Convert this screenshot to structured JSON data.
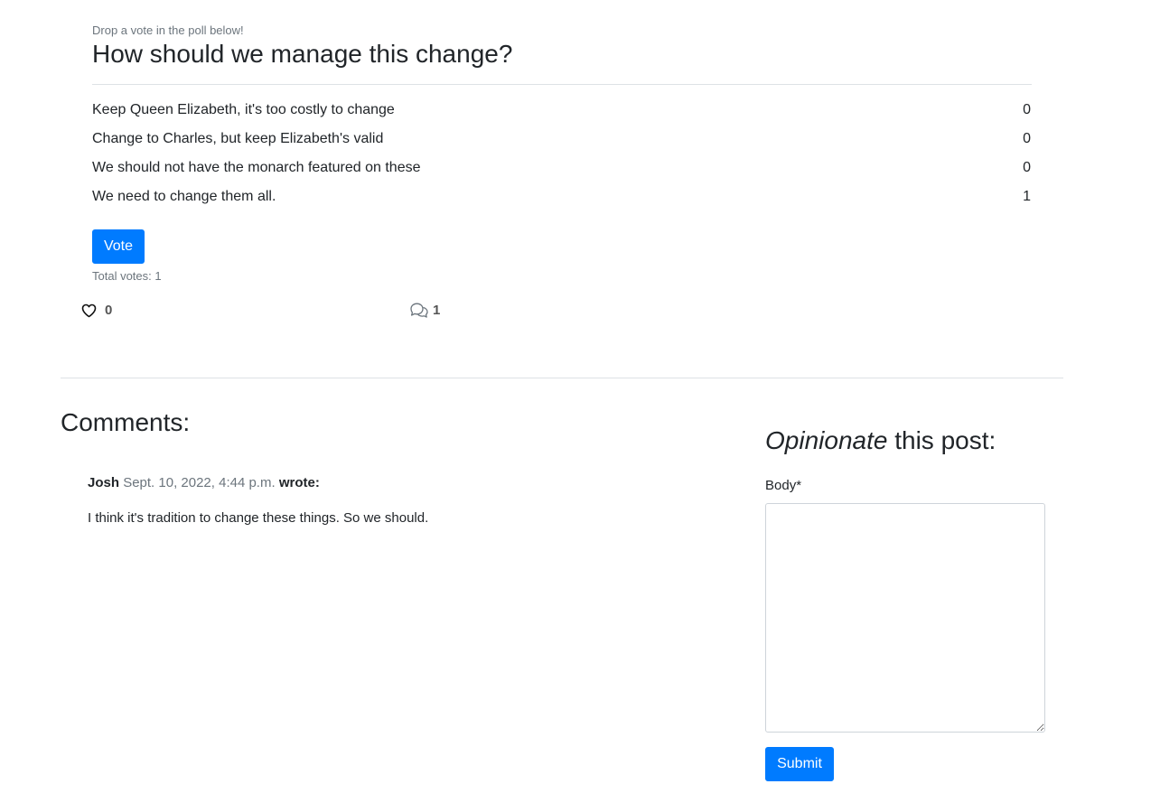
{
  "poll": {
    "hint": "Drop a vote in the poll below!",
    "question": "How should we manage this change?",
    "options": [
      {
        "label": "Keep Queen Elizabeth, it's too costly to change",
        "votes": "0"
      },
      {
        "label": "Change to Charles, but keep Elizabeth's valid",
        "votes": "0"
      },
      {
        "label": "We should not have the monarch featured on these",
        "votes": "0"
      },
      {
        "label": "We need to change them all.",
        "votes": "1"
      }
    ],
    "vote_label": "Vote",
    "total_votes_text": "Total votes: 1"
  },
  "stats": {
    "likes": "0",
    "likes_icon": "heart-icon",
    "comments": "1",
    "comments_icon": "chat-bubbles-icon"
  },
  "comments": {
    "heading": "Comments:",
    "items": [
      {
        "author": "Josh",
        "date": "Sept. 10, 2022, 4:44 p.m.",
        "wrote": "wrote:",
        "body": "I think it's tradition to change these things. So we should."
      }
    ]
  },
  "form": {
    "heading_em": "Opinionate",
    "heading_rest": " this post:",
    "body_label": "Body*",
    "body_value": "",
    "submit_label": "Submit"
  },
  "colors": {
    "primary": "#007bff",
    "muted": "#6c757d",
    "text": "#212529",
    "border": "#dee2e6"
  }
}
